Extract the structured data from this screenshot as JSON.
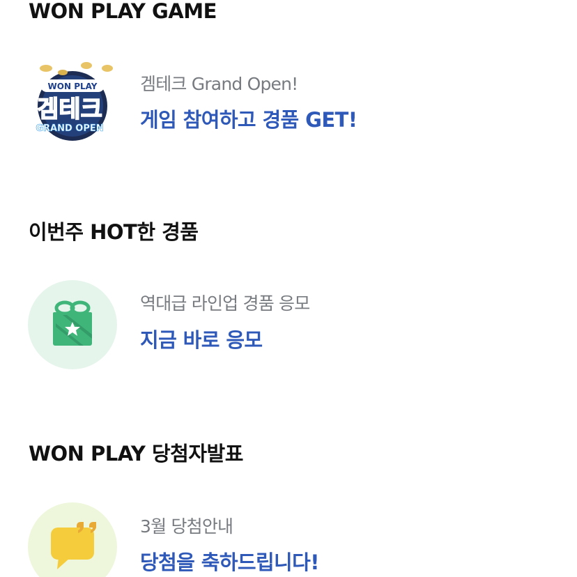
{
  "sections": [
    {
      "title": "WON PLAY GAME",
      "card": {
        "subtitle": "겜테크 Grand Open!",
        "headline": "게임 참여하고 경품 GET!",
        "icon": "game-logo-icon",
        "logo_text_top": "WON PLAY",
        "logo_text_main": "겜테크",
        "logo_text_bottom": "GRAND OPEN"
      }
    },
    {
      "title": "이번주 HOT한 경품",
      "card": {
        "subtitle": "역대급 라인업 경품 응모",
        "headline": "지금 바로 응모",
        "icon": "gift-box-icon"
      }
    },
    {
      "title": "WON PLAY 당첨자발표",
      "card": {
        "subtitle": "3월 당첨안내",
        "headline": "당첨을 축하드립니다!",
        "icon": "speech-bubble-icon"
      }
    }
  ],
  "colors": {
    "title": "#111111",
    "subtitle": "#777b80",
    "headline": "#2f59b8",
    "gift_bg": "#e6f5ec",
    "gift_box": "#3fb57a",
    "bubble_bg": "#eef7dc",
    "bubble": "#f5cd3c"
  }
}
